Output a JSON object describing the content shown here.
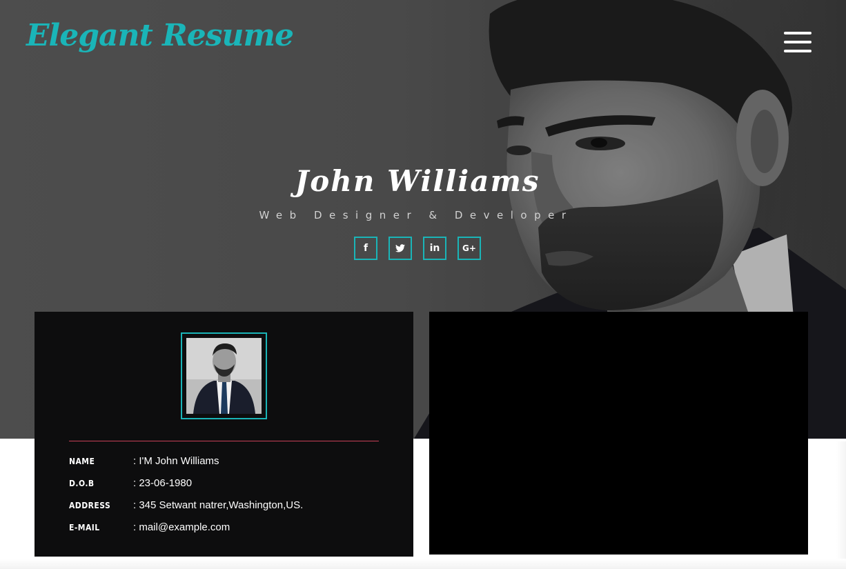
{
  "brand": {
    "logo_text": "Elegant Resume",
    "accent_color": "#1ab5b8"
  },
  "header": {
    "menu_icon": "hamburger-menu-icon"
  },
  "hero": {
    "name": "John Williams",
    "role": "Web Designer & Developer",
    "social": [
      {
        "icon": "facebook-icon",
        "glyph": "f"
      },
      {
        "icon": "twitter-icon",
        "glyph": ""
      },
      {
        "icon": "linkedin-icon",
        "glyph": "in"
      },
      {
        "icon": "google-plus-icon",
        "glyph": "G+"
      }
    ]
  },
  "profile": {
    "divider_color": "#c94057",
    "rows": [
      {
        "label": "NAME",
        "value": ": I'M John Williams"
      },
      {
        "label": "D.O.B",
        "value": ": 23-06-1980"
      },
      {
        "label": "ADDRESS",
        "value": ": 345 Setwant natrer,Washington,US."
      },
      {
        "label": "E-MAIL",
        "value": ": mail@example.com"
      }
    ]
  }
}
